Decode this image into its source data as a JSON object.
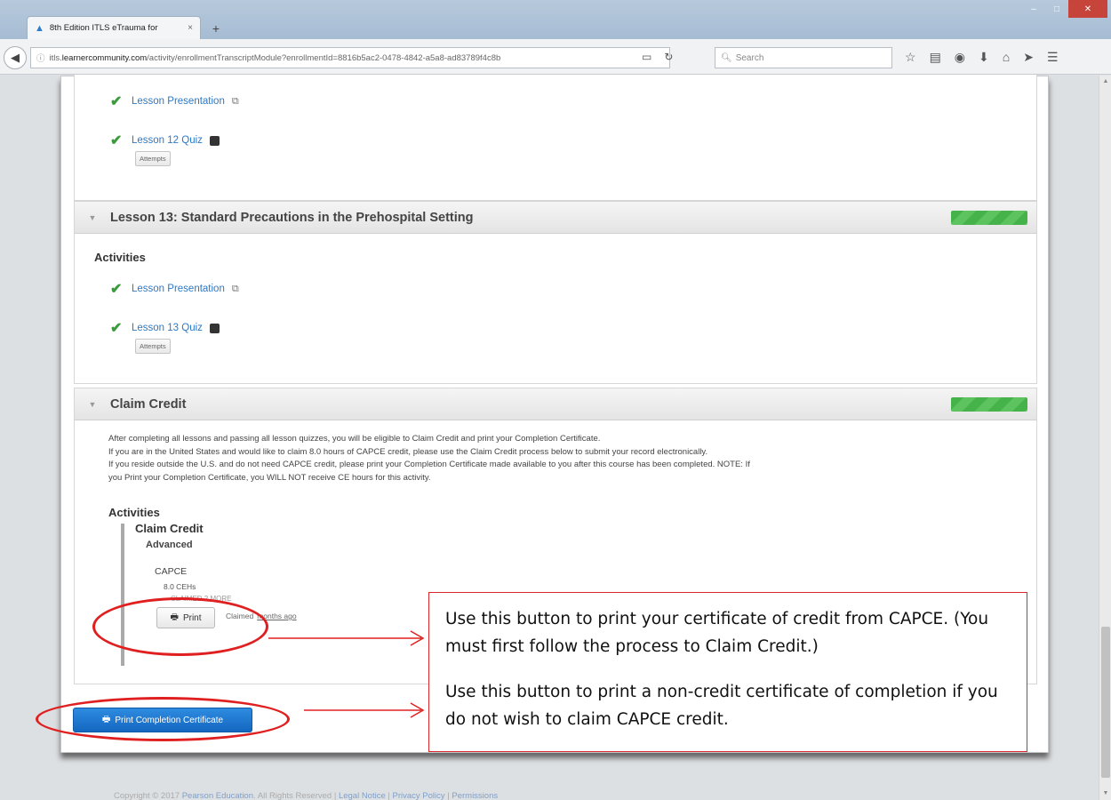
{
  "browser": {
    "tab_title": "8th Edition ITLS eTrauma for",
    "tab_close": "×",
    "new_tab": "+",
    "url_prefix": "itls.",
    "url_host": "learnercommunity.com",
    "url_path": "/activity/enrollmentTranscriptModule?enrollmentId=8816b5ac2-0478-4842-a5a8-ad83789f4c8b",
    "search_placeholder": "Search"
  },
  "sections": {
    "lesson12": {
      "presentation_link": "Lesson Presentation",
      "quiz_link": "Lesson 12 Quiz",
      "attempts_label": "Attempts"
    },
    "lesson13": {
      "title": "Lesson 13: Standard Precautions in the Prehospital Setting",
      "activities_heading": "Activities",
      "presentation_link": "Lesson Presentation",
      "quiz_link": "Lesson 13 Quiz",
      "attempts_label": "Attempts"
    },
    "claim_credit": {
      "title": "Claim Credit",
      "description_lines": [
        "After completing all lessons and passing all lesson quizzes, you will be eligible to Claim Credit and print your Completion Certificate.",
        "If you are in the United States and would like to claim 8.0 hours of CAPCE credit, please use the Claim Credit process below to submit your record electronically.",
        "If you reside outside the U.S. and do not need CAPCE credit, please print your Completion Certificate made available to you after this course has been completed. NOTE: If",
        "you Print your Completion Certificate, you WILL NOT receive CE hours for this activity."
      ],
      "activities_heading": "Activities",
      "activity_title": "Claim Credit",
      "level": "Advanced",
      "provider": "CAPCE",
      "hours": "8.0 CEHs",
      "status_faded": "CLAIMED 2 MORE",
      "print_label": "Print",
      "claimed_label": "Claimed",
      "claimed_ago": "months ago"
    }
  },
  "print_completion_label": "Print Completion Certificate",
  "footer": {
    "copyright": "Copyright © 2017",
    "company": "Pearson Education",
    "rights": ". All Rights Reserved |",
    "legal": "Legal Notice",
    "sep1": "|",
    "privacy": "Privacy Policy",
    "sep2": "|",
    "permissions": "Permissions"
  },
  "annotations": {
    "callout_print": "Use this button to print your certificate of credit from CAPCE. (You must first follow the process to Claim Credit.)",
    "callout_completion": "Use this button to print a non-credit certificate of completion if you do not wish to claim CAPCE credit."
  },
  "colors": {
    "link": "#2a79c7",
    "check": "#3a9b3a",
    "progress": "#46b24a",
    "primary_button": "#1467c0",
    "annotation_red": "#e02020"
  }
}
